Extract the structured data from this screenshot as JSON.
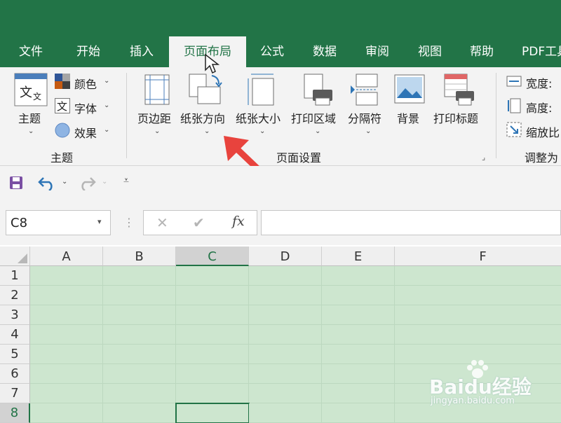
{
  "tabs": [
    {
      "label": "文件"
    },
    {
      "label": "开始"
    },
    {
      "label": "插入"
    },
    {
      "label": "页面布局"
    },
    {
      "label": "公式"
    },
    {
      "label": "数据"
    },
    {
      "label": "审阅"
    },
    {
      "label": "视图"
    },
    {
      "label": "帮助"
    },
    {
      "label": "PDF工具"
    }
  ],
  "ribbon": {
    "theme_group": {
      "themes_label": "主题",
      "colors_label": "颜色",
      "fonts_label": "字体",
      "effects_label": "效果",
      "group_label": "主题"
    },
    "page_setup_group": {
      "margins_label": "页边距",
      "orientation_label": "纸张方向",
      "size_label": "纸张大小",
      "print_area_label": "打印区域",
      "breaks_label": "分隔符",
      "background_label": "背景",
      "print_titles_label": "打印标题",
      "group_label": "页面设置"
    },
    "scale_group": {
      "width_label": "宽度:",
      "height_label": "高度:",
      "scale_label": "缩放比",
      "group_label": "调整为"
    }
  },
  "name_box": {
    "value": "C8"
  },
  "formula_bar": {
    "fx_label": "fx",
    "value": ""
  },
  "grid": {
    "columns": [
      "A",
      "B",
      "C",
      "D",
      "E",
      "F"
    ],
    "rows": [
      "1",
      "2",
      "3",
      "4",
      "5",
      "6",
      "7",
      "8"
    ],
    "selected_column": "C",
    "selected_row": "8"
  },
  "watermark": {
    "brand": "Baidu经验",
    "url": "jingyan.baidu.com"
  },
  "colors": {
    "accent": "#227447",
    "cell_fill": "#cde6cf",
    "arrow": "#e8433d"
  }
}
